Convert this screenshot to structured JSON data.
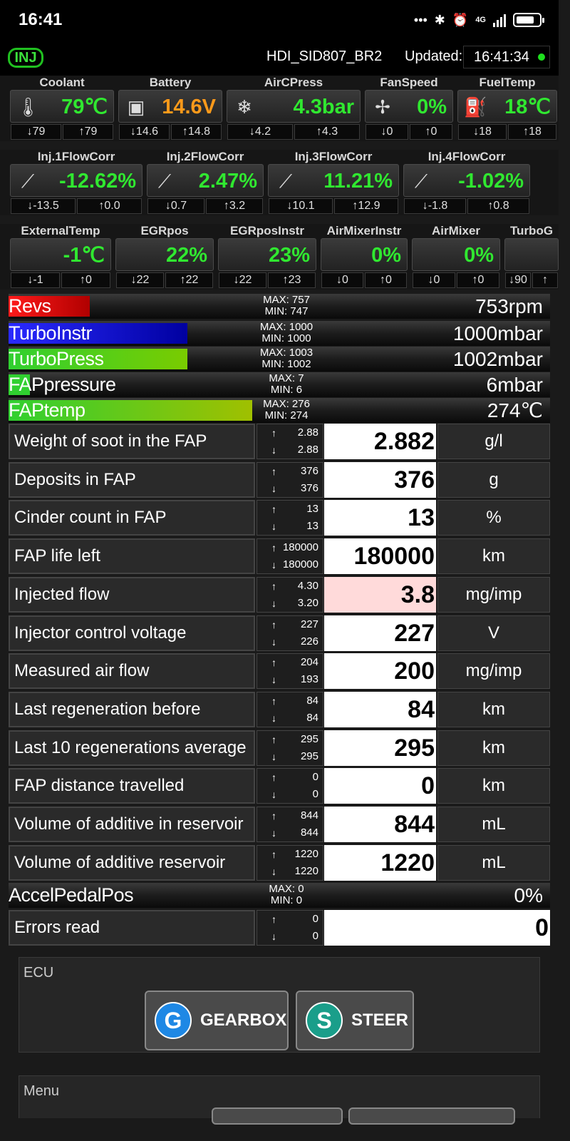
{
  "status": {
    "time": "16:41",
    "net": "4G",
    "dots": "•••",
    "bt": "✱",
    "alarm": "⏰"
  },
  "header": {
    "logo": "INJ",
    "ecu": "HDI_SID807_BR2",
    "updated_label": "Updated:",
    "updated_time": "16:41:34"
  },
  "row1": [
    {
      "title": "Coolant",
      "icon": "thermometer-icon",
      "glyph": "🌡",
      "value": "79℃",
      "min": "79",
      "max": "79",
      "color": "#30e830"
    },
    {
      "title": "Battery",
      "icon": "battery-icon",
      "glyph": "▣",
      "value": "14.6V",
      "min": "14.6",
      "max": "14.8",
      "color": "#ff9a1a"
    },
    {
      "title": "AirCPress",
      "icon": "snowflake-icon",
      "glyph": "❄",
      "value": "4.3bar",
      "min": "4.2",
      "max": "4.3",
      "color": "#30e830"
    },
    {
      "title": "FanSpeed",
      "icon": "fan-icon",
      "glyph": "✢",
      "value": "0%",
      "min": "0",
      "max": "0",
      "color": "#30e830"
    },
    {
      "title": "FuelTemp",
      "icon": "fuel-pump-icon",
      "glyph": "⛽",
      "value": "18℃",
      "min": "18",
      "max": "18",
      "color": "#30e830"
    }
  ],
  "row2": [
    {
      "title": "Inj.1FlowCorr",
      "icon": "injector-icon",
      "glyph": "⟋",
      "value": "-12.62%",
      "min": "-13.5",
      "max": "0.0"
    },
    {
      "title": "Inj.2FlowCorr",
      "icon": "injector-icon",
      "glyph": "⟋",
      "value": "2.47%",
      "min": "0.7",
      "max": "3.2"
    },
    {
      "title": "Inj.3FlowCorr",
      "icon": "injector-icon",
      "glyph": "⟋",
      "value": "11.21%",
      "min": "10.1",
      "max": "12.9"
    },
    {
      "title": "Inj.4FlowCorr",
      "icon": "injector-icon",
      "glyph": "⟋",
      "value": "-1.02%",
      "min": "-1.8",
      "max": "0.8"
    }
  ],
  "row3": [
    {
      "title": "ExternalTemp",
      "value": "-1℃",
      "min": "-1",
      "max": "0"
    },
    {
      "title": "EGRpos",
      "value": "22%",
      "min": "22",
      "max": "22"
    },
    {
      "title": "EGRposInstr",
      "value": "23%",
      "min": "22",
      "max": "23"
    },
    {
      "title": "AirMixerInstr",
      "value": "0%",
      "min": "0",
      "max": "0"
    },
    {
      "title": "AirMixer",
      "value": "0%",
      "min": "0",
      "max": "0"
    },
    {
      "title": "TurboG",
      "value": "",
      "min": "90",
      "max": ""
    }
  ],
  "bars": [
    {
      "label": "Revs",
      "max": "MAX: 757",
      "min": "MIN: 747",
      "value": "753rpm",
      "fill": 0.15,
      "color": "linear-gradient(90deg,#ff1a1a,#b00000)"
    },
    {
      "label": "TurboInstr",
      "max": "MAX: 1000",
      "min": "MIN: 1000",
      "value": "1000mbar",
      "fill": 0.33,
      "color": "linear-gradient(90deg,#2a2aff,#0000a0)"
    },
    {
      "label": "TurboPress",
      "max": "MAX: 1003",
      "min": "MIN: 1002",
      "value": "1002mbar",
      "fill": 0.33,
      "color": "linear-gradient(90deg,#30d030,#7acc00)"
    },
    {
      "label": "FAPpressure",
      "max": "MAX: 7",
      "min": "MIN: 6",
      "value": "6mbar",
      "fill": 0.04,
      "color": "#30d030"
    },
    {
      "label": "FAPtemp",
      "max": "MAX: 276",
      "min": "MIN: 274",
      "value": "274℃",
      "fill": 0.45,
      "color": "linear-gradient(90deg,#30d030,#a0c000)"
    }
  ],
  "rows": [
    {
      "label": "Weight of soot in the FAP",
      "max": "2.88",
      "min": "2.88",
      "value": "2.882",
      "unit": "g/l"
    },
    {
      "label": "Deposits in FAP",
      "max": "376",
      "min": "376",
      "value": "376",
      "unit": "g"
    },
    {
      "label": "Cinder count in FAP",
      "max": "13",
      "min": "13",
      "value": "13",
      "unit": "%"
    },
    {
      "label": "FAP life left",
      "max": "180000",
      "min": "180000",
      "value": "180000",
      "unit": "km"
    },
    {
      "label": "Injected flow",
      "max": "4.30",
      "min": "3.20",
      "value": "3.8",
      "unit": "mg/imp",
      "pink": true
    },
    {
      "label": "Injector control voltage",
      "max": "227",
      "min": "226",
      "value": "227",
      "unit": "V"
    },
    {
      "label": "Measured air flow",
      "max": "204",
      "min": "193",
      "value": "200",
      "unit": "mg/imp"
    },
    {
      "label": "Last regeneration before",
      "max": "84",
      "min": "84",
      "value": "84",
      "unit": "km"
    },
    {
      "label": "Last 10 regenerations average",
      "max": "295",
      "min": "295",
      "value": "295",
      "unit": "km"
    },
    {
      "label": "FAP distance travelled",
      "max": "0",
      "min": "0",
      "value": "0",
      "unit": "km"
    },
    {
      "label": "Volume of additive in reservoir",
      "max": "844",
      "min": "844",
      "value": "844",
      "unit": "mL"
    },
    {
      "label": "Volume of additive reservoir",
      "max": "1220",
      "min": "1220",
      "value": "1220",
      "unit": "mL"
    }
  ],
  "accel": {
    "label": "AccelPedalPos",
    "max": "MAX: 0",
    "min": "MIN: 0",
    "value": "0%"
  },
  "errors": {
    "label": "Errors read",
    "max": "0",
    "min": "0",
    "value": "0"
  },
  "ecu_panel": {
    "title": "ECU",
    "buttons": [
      {
        "badge": "G",
        "label": "GEARBOX",
        "color": "#1e88e5"
      },
      {
        "badge": "S",
        "label": "STEER",
        "color": "#1a9e8a"
      }
    ]
  },
  "menu_panel": {
    "title": "Menu"
  },
  "arrows": {
    "up": "↑",
    "down": "↓"
  }
}
